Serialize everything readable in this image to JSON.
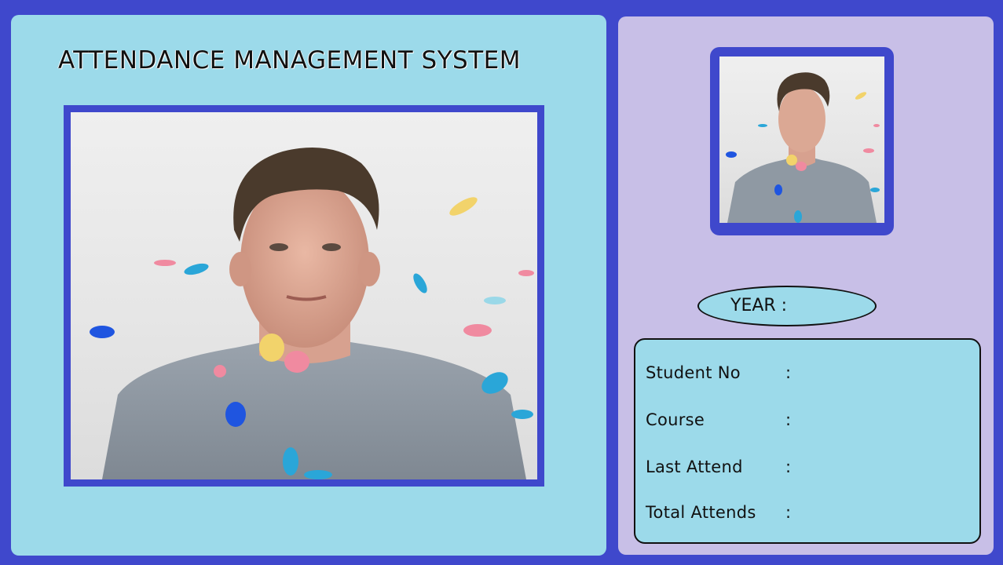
{
  "app": {
    "title": "ATTENDANCE MANAGEMENT SYSTEM"
  },
  "photo": {
    "description_icon": "student-photo"
  },
  "year": {
    "label": "YEAR :",
    "value": ""
  },
  "student_info": [
    {
      "label": "Student No",
      "separator": ":",
      "value": ""
    },
    {
      "label": "Course",
      "separator": ":",
      "value": ""
    },
    {
      "label": "Last Attend",
      "separator": ":",
      "value": ""
    },
    {
      "label": "Total Attends",
      "separator": ":",
      "value": ""
    }
  ],
  "colors": {
    "frame": "#3f48cc",
    "left_panel": "#9cdaea",
    "right_panel": "#c8bfe7"
  }
}
